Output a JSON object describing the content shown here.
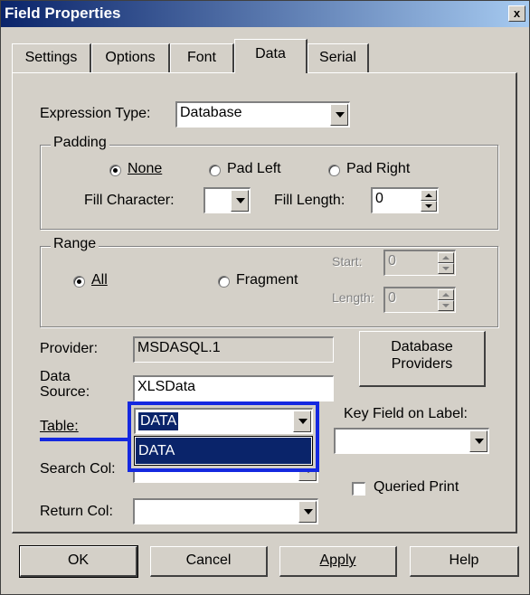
{
  "window": {
    "title": "Field Properties",
    "close_label": "x"
  },
  "tabs": [
    {
      "label": "Settings"
    },
    {
      "label": "Options"
    },
    {
      "label": "Font"
    },
    {
      "label": "Data"
    },
    {
      "label": "Serial"
    }
  ],
  "expression": {
    "label": "Expression Type:",
    "value": "Database"
  },
  "padding": {
    "title": "Padding",
    "none": "None",
    "pad_left": "Pad Left",
    "pad_right": "Pad Right",
    "fill_char_label": "Fill Character:",
    "fill_char_value": "",
    "fill_len_label": "Fill Length:",
    "fill_len_value": "0"
  },
  "range": {
    "title": "Range",
    "all": "All",
    "fragment": "Fragment",
    "start_label": "Start:",
    "start_value": "0",
    "length_label": "Length:",
    "length_value": "0"
  },
  "provider": {
    "label": "Provider:",
    "value": "MSDASQL.1"
  },
  "data_source": {
    "label_line1": "Data",
    "label_line2": "Source:",
    "value": "XLSData"
  },
  "table": {
    "label": "Table:",
    "value": "DATA",
    "options": [
      "DATA"
    ]
  },
  "search_col": {
    "label": "Search Col:",
    "value": ""
  },
  "return_col": {
    "label": "Return Col:",
    "value": ""
  },
  "db_providers_button": {
    "line1": "Database",
    "line2": "Providers"
  },
  "key_field": {
    "label": "Key Field on Label:",
    "value": ""
  },
  "queried_print": {
    "label": "Queried Print",
    "checked": false
  },
  "buttons": {
    "ok": "OK",
    "cancel": "Cancel",
    "apply": "Apply",
    "help": "Help"
  },
  "colors": {
    "title_bar": "#0a246a",
    "selection": "#0a246a",
    "highlight_box": "#1428e0",
    "face": "#d4d0c8"
  }
}
